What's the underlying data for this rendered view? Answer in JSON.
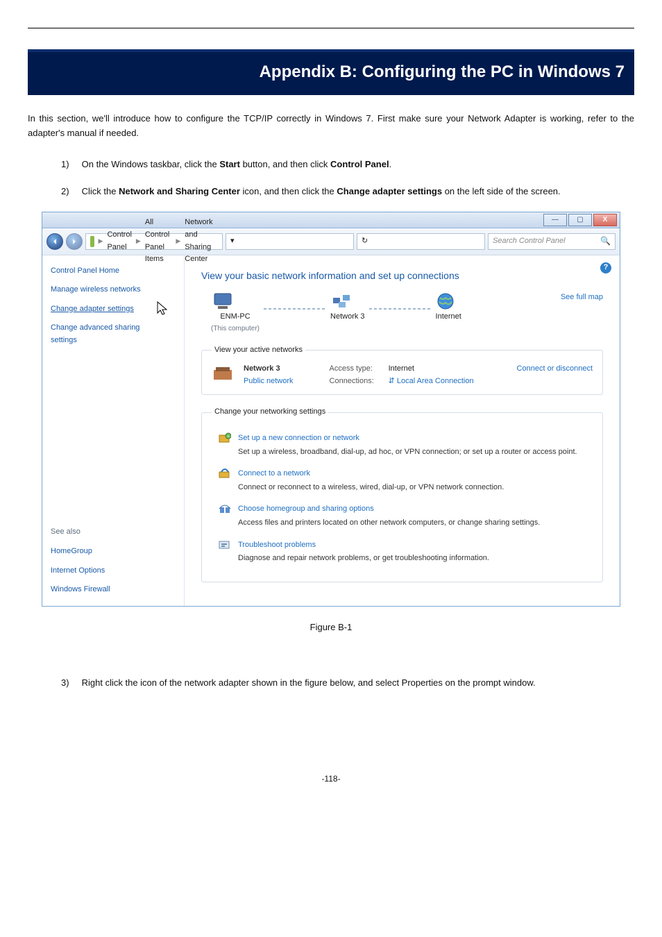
{
  "banner": "Appendix B: Configuring the PC in Windows 7",
  "intro": "In this section, we'll introduce how to configure the TCP/IP correctly in Windows 7. First make sure your Network Adapter is working, refer to the adapter's manual if needed.",
  "steps": {
    "s1": {
      "num": "1)",
      "pre": "On the Windows taskbar, click the ",
      "b1": "Start",
      "mid": " button, and then click ",
      "b2": "Control Panel",
      "post": "."
    },
    "s2": {
      "num": "2)",
      "pre": "Click the ",
      "b1": "Network and Sharing Center",
      "mid": " icon, and then click the ",
      "b2": "Change adapter settings",
      "post": " on the left side of the screen."
    },
    "s3": {
      "num": "3)",
      "text": "Right click the icon of the network adapter shown in the figure below, and select Properties on the prompt window."
    }
  },
  "caption": "Figure B-1",
  "footer": "-118-",
  "shot": {
    "breadcrumb": {
      "cp": "Control Panel",
      "all": "All Control Panel Items",
      "nsc": "Network and Sharing Center"
    },
    "search_placeholder": "Search Control Panel",
    "leftnav": {
      "home": "Control Panel Home",
      "l1": "Manage wireless networks",
      "l2": "Change adapter settings",
      "l3a": "Change advanced sharing",
      "l3b": "settings",
      "see_also": "See also",
      "sa1": "HomeGroup",
      "sa2": "Internet Options",
      "sa3": "Windows Firewall"
    },
    "main": {
      "heading": "View your basic network information and set up connections",
      "see_full_map": "See full map",
      "comp_name": "ENM-PC",
      "this_computer": "(This computer)",
      "net_name": "Network 3",
      "internet": "Internet",
      "view_active": "View your active networks",
      "connect_or_disconnect": "Connect or disconnect",
      "public_network": "Public network",
      "atype_label": "Access type:",
      "atype_value": "Internet",
      "conn_label": "Connections:",
      "conn_value": "Local Area Connection",
      "change_settings": "Change your networking settings",
      "opts": {
        "o1h": "Set up a new connection or network",
        "o1d": "Set up a wireless, broadband, dial-up, ad hoc, or VPN connection; or set up a router or access point.",
        "o2h": "Connect to a network",
        "o2d": "Connect or reconnect to a wireless, wired, dial-up, or VPN network connection.",
        "o3h": "Choose homegroup and sharing options",
        "o3d": "Access files and printers located on other network computers, or change sharing settings.",
        "o4h": "Troubleshoot problems",
        "o4d": "Diagnose and repair network problems, or get troubleshooting information."
      }
    },
    "title_buttons": {
      "min": "—",
      "max": "▢",
      "close": "X"
    }
  }
}
